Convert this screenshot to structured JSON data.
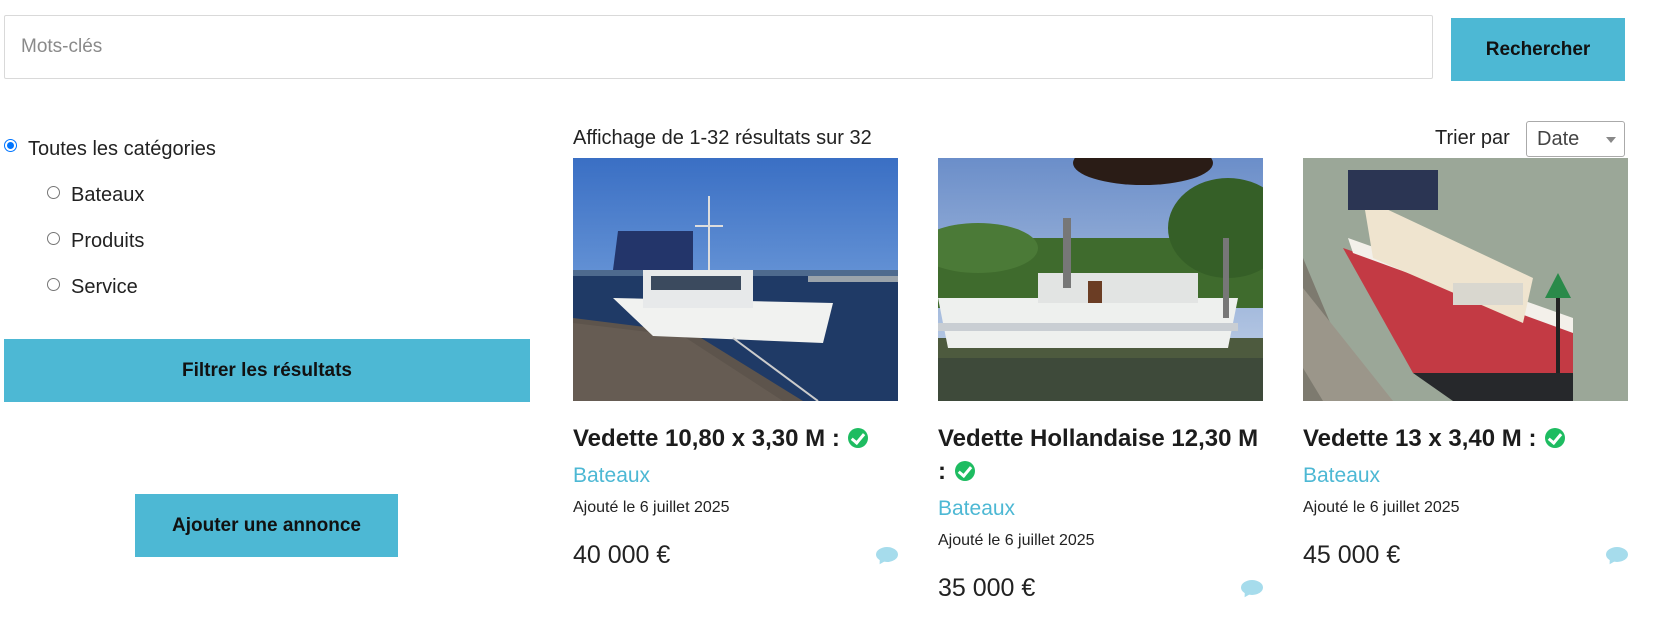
{
  "search": {
    "placeholder": "Mots-clés",
    "value": "",
    "button_label": "Rechercher"
  },
  "categories": {
    "all_label": "Toutes les catégories",
    "items": [
      {
        "label": "Bateaux"
      },
      {
        "label": "Produits"
      },
      {
        "label": "Service"
      }
    ],
    "selected": "Toutes les catégories"
  },
  "sidebar": {
    "filter_button_label": "Filtrer les résultats",
    "add_button_label": "Ajouter une annonce"
  },
  "results": {
    "count_text": "Affichage de 1-32 résultats sur 32",
    "sort_label": "Trier par",
    "sort_value": "Date"
  },
  "listings": [
    {
      "title": "Vedette 10,80 x 3,30 M :",
      "verified_icon": "check-circle-icon",
      "category": "Bateaux",
      "added": "Ajouté le 6 juillet 2025",
      "price": "40 000 €",
      "photo": "boat-white-blue-canopy"
    },
    {
      "title": "Vedette Hollandaise 12,30 M :",
      "verified_icon": "check-circle-icon",
      "category": "Bateaux",
      "added": "Ajouté le 6 juillet 2025",
      "price": "35 000 €",
      "photo": "boat-white-river"
    },
    {
      "title": "Vedette 13 x 3,40 M :",
      "verified_icon": "check-circle-icon",
      "category": "Bateaux",
      "added": "Ajouté le 6 juillet 2025",
      "price": "45 000 €",
      "photo": "boat-red-cream"
    }
  ],
  "colors": {
    "accent": "#4db8d4",
    "verified": "#1ebc61",
    "chat_icon": "#a6dcec",
    "radio_selected": "#0075ff"
  }
}
